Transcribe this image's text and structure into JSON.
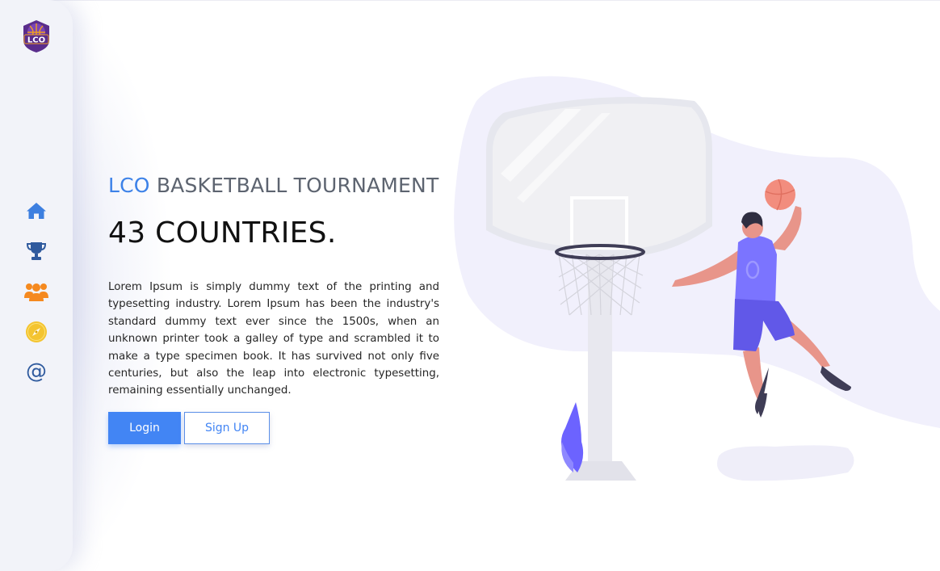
{
  "sidebar": {
    "logo": {
      "text": "LCO",
      "icon": "basketball-logo"
    },
    "nav": [
      {
        "icon": "home-icon",
        "color": "#3d7fe0"
      },
      {
        "icon": "trophy-icon",
        "color": "#2f5a9e"
      },
      {
        "icon": "users-icon",
        "color": "#f5891f"
      },
      {
        "icon": "compass-icon",
        "color": "#f4c430"
      },
      {
        "icon": "at-icon",
        "glyph": "@",
        "color": "#2f5a9e"
      }
    ]
  },
  "hero": {
    "subtitle_accent": "LCO",
    "subtitle_rest": " BASKETBALL TOURNAMENT",
    "headline": "43 COUNTRIES.",
    "body": "Lorem Ipsum is simply dummy text of the printing and typesetting industry. Lorem Ipsum has been the industry's standard dummy text ever since the 1500s, when an unknown printer took a galley of type and scrambled it to make a type specimen book. It has survived not only five centuries, but also the leap into electronic typesetting, remaining essentially unchanged.",
    "login_label": "Login",
    "signup_label": "Sign Up"
  },
  "illustration": {
    "player_jersey_number": "0"
  },
  "colors": {
    "accent": "#3d82e8",
    "button": "#4285f4",
    "sidebar_bg": "#f2f3f9",
    "blob": "#f1f0fc",
    "jersey": "#6c63ff",
    "ball": "#f28d7e"
  }
}
